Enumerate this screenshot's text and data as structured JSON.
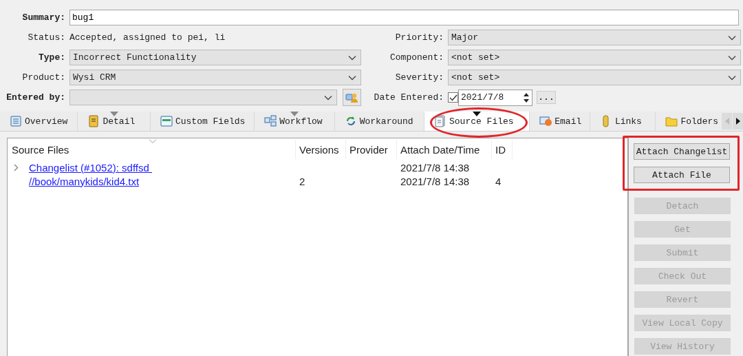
{
  "form": {
    "summary": {
      "label": "Summary:",
      "value": "bug1"
    },
    "left": [
      {
        "kind": "text",
        "label": "Status:",
        "value": "Accepted, assigned to pei, li",
        "bold": false
      },
      {
        "kind": "combo",
        "label": "Type:",
        "value": "Incorrect Functionality",
        "bold": true
      },
      {
        "kind": "combo",
        "label": "Product:",
        "value": "Wysi CRM",
        "bold": false
      },
      {
        "kind": "combo-button",
        "label": "Entered by:",
        "bold": true
      }
    ],
    "right": [
      {
        "kind": "combo",
        "label": "Priority:",
        "value": "Major"
      },
      {
        "kind": "combo",
        "label": "Component:",
        "value": "<not set>"
      },
      {
        "kind": "combo",
        "label": "Severity:",
        "value": "<not set>"
      },
      {
        "kind": "date",
        "label": "Date Entered:",
        "value": "2021/7/8",
        "checked": true,
        "button": "..."
      }
    ]
  },
  "tabs": [
    {
      "label": "Overview",
      "selected": false,
      "has_menu": false,
      "circled": false
    },
    {
      "label": "Detail",
      "selected": false,
      "has_menu": true,
      "circled": false
    },
    {
      "label": "Custom Fields",
      "selected": false,
      "has_menu": false,
      "circled": false
    },
    {
      "label": "Workflow",
      "selected": false,
      "has_menu": true,
      "circled": false
    },
    {
      "label": "Workaround",
      "selected": false,
      "has_menu": false,
      "circled": false
    },
    {
      "label": "Source Files",
      "selected": true,
      "has_menu": true,
      "circled": true
    },
    {
      "label": "Email",
      "selected": false,
      "has_menu": false,
      "circled": false
    },
    {
      "label": "Links",
      "selected": false,
      "has_menu": false,
      "circled": false
    },
    {
      "label": "Folders",
      "selected": false,
      "has_menu": false,
      "circled": false
    }
  ],
  "table": {
    "columns": [
      "Source Files",
      "Versions",
      "Provider",
      "Attach Date/Time",
      "ID"
    ],
    "rows": [
      {
        "expandable": true,
        "cells": [
          "Changelist (#1052): sdffsd ",
          "",
          "",
          "2021/7/8 14:38",
          ""
        ]
      },
      {
        "expandable": false,
        "cells": [
          "//book/manykids/kid4.txt",
          "2",
          "",
          "2021/7/8 14:38",
          "4"
        ]
      }
    ]
  },
  "actions": [
    {
      "label": "Attach Changelist",
      "disabled": false,
      "boxed": true
    },
    {
      "label": "Attach File",
      "disabled": false,
      "boxed": true
    },
    {
      "label": "Detach",
      "disabled": true,
      "boxed": false
    },
    {
      "label": "Get",
      "disabled": true,
      "boxed": false
    },
    {
      "label": "Submit",
      "disabled": true,
      "boxed": false
    },
    {
      "label": "Check Out",
      "disabled": true,
      "boxed": false
    },
    {
      "label": "Revert",
      "disabled": true,
      "boxed": false
    },
    {
      "label": "View Local Copy",
      "disabled": true,
      "boxed": false
    },
    {
      "label": "View History",
      "disabled": true,
      "boxed": false
    }
  ]
}
